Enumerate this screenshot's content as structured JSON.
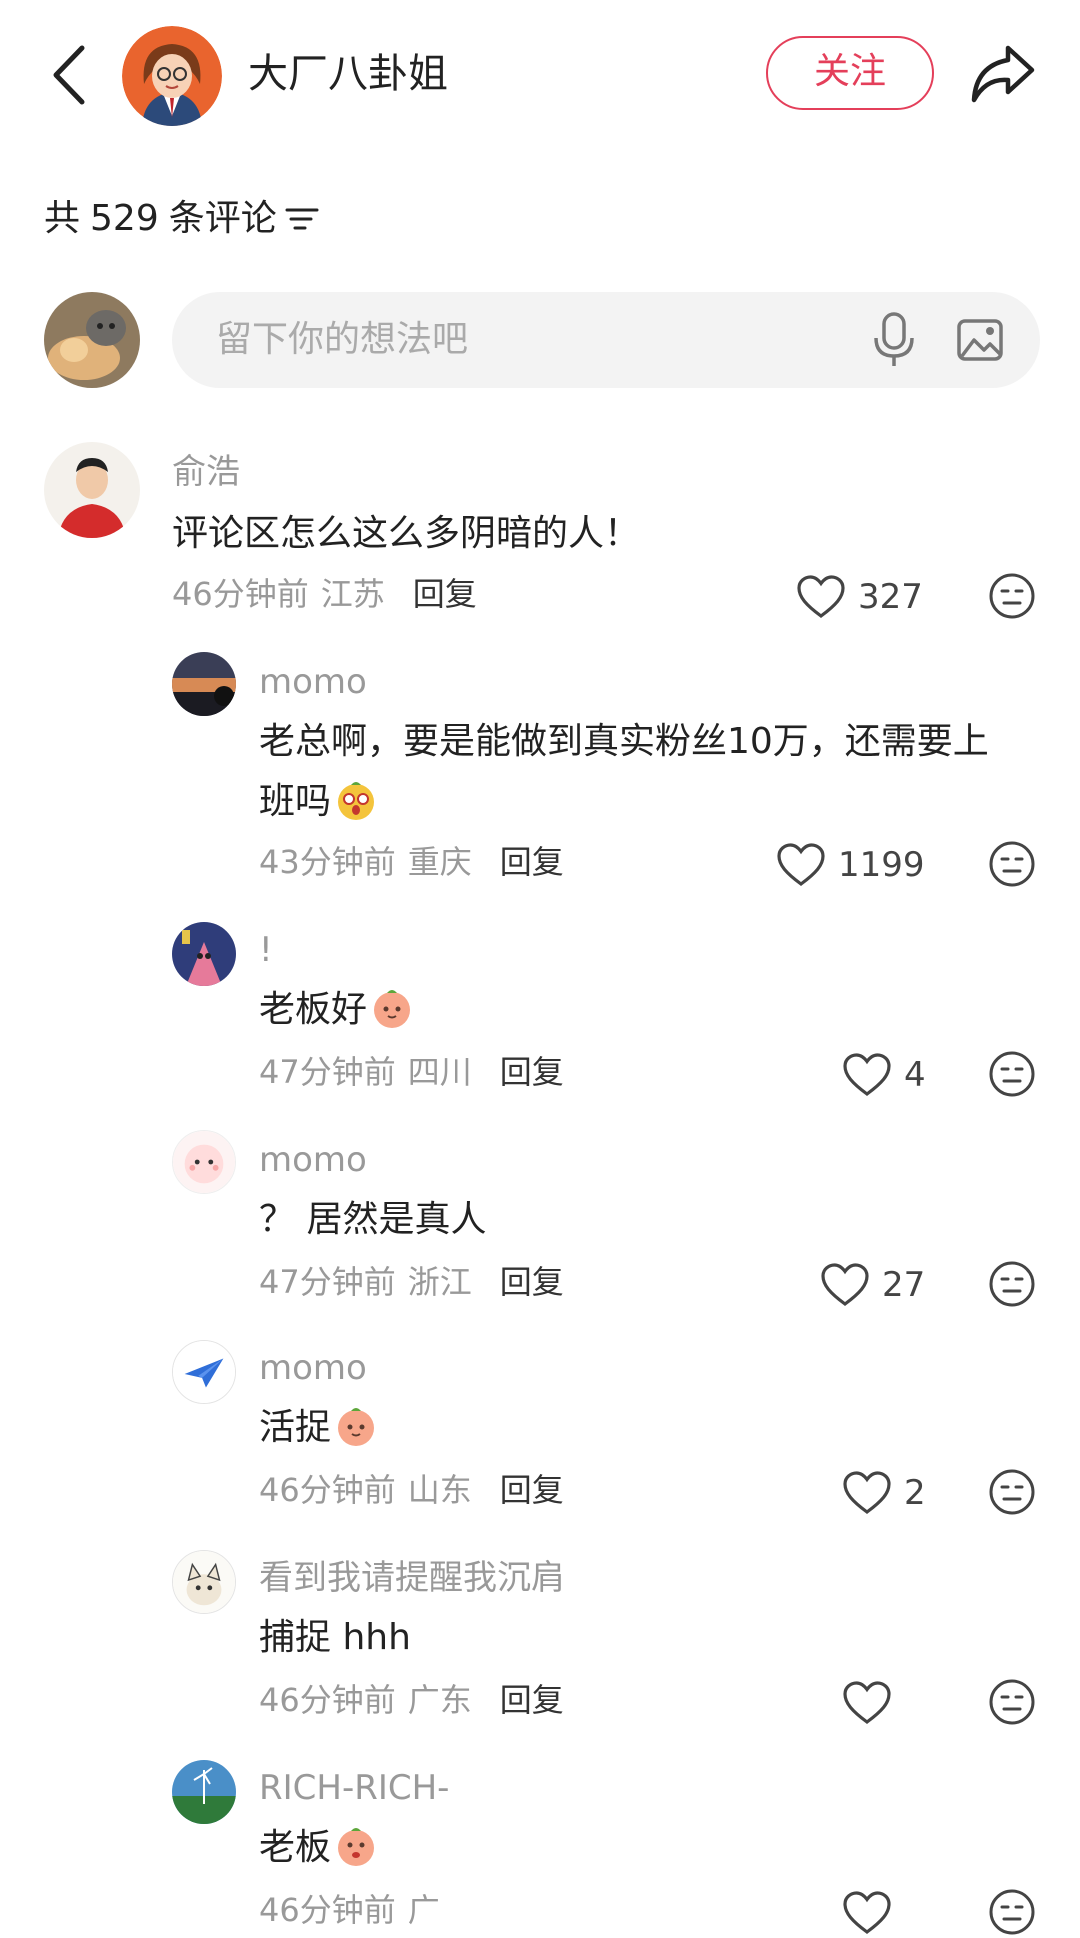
{
  "header": {
    "author_name": "大厂八卦姐",
    "follow_label": "关注"
  },
  "comments_header": {
    "prefix": "共",
    "count": "529",
    "suffix": "条评论"
  },
  "input": {
    "placeholder": "留下你的想法吧"
  },
  "comments": [
    {
      "user": "俞浩",
      "text": "评论区怎么这么多阴暗的人！",
      "time": "46分钟前",
      "location": "江苏",
      "reply": "回复",
      "likes": "327"
    },
    {
      "user": "momo",
      "text": "老总啊，要是能做到真实粉丝10万，还需要上",
      "text2": "班吗",
      "time": "43分钟前",
      "location": "重庆",
      "reply": "回复",
      "likes": "1199"
    },
    {
      "user": "!",
      "text": "老板好",
      "time": "47分钟前",
      "location": "四川",
      "reply": "回复",
      "likes": "4"
    },
    {
      "user": "momo",
      "text": "？ 居然是真人",
      "time": "47分钟前",
      "location": "浙江",
      "reply": "回复",
      "likes": "27"
    },
    {
      "user": "momo",
      "text": "活捉",
      "time": "46分钟前",
      "location": "山东",
      "reply": "回复",
      "likes": "2"
    },
    {
      "user": "看到我请提醒我沉肩",
      "text": "捕捉 hhh",
      "time": "46分钟前",
      "location": "广东",
      "reply": "回复",
      "likes": ""
    },
    {
      "user": "RICH-RICH-",
      "text": "老板",
      "time": "46分钟前",
      "location": "广",
      "reply": "",
      "likes": ""
    }
  ],
  "colors": {
    "accent": "#e43f5a",
    "muted": "#999999",
    "input_bg": "#f3f3f3"
  },
  "icons": [
    "back-arrow-icon",
    "share-icon",
    "filter-icon",
    "microphone-icon",
    "image-icon",
    "heart-icon",
    "neutral-face-icon",
    "peach-emoji-icon",
    "surprised-emoji-icon"
  ]
}
